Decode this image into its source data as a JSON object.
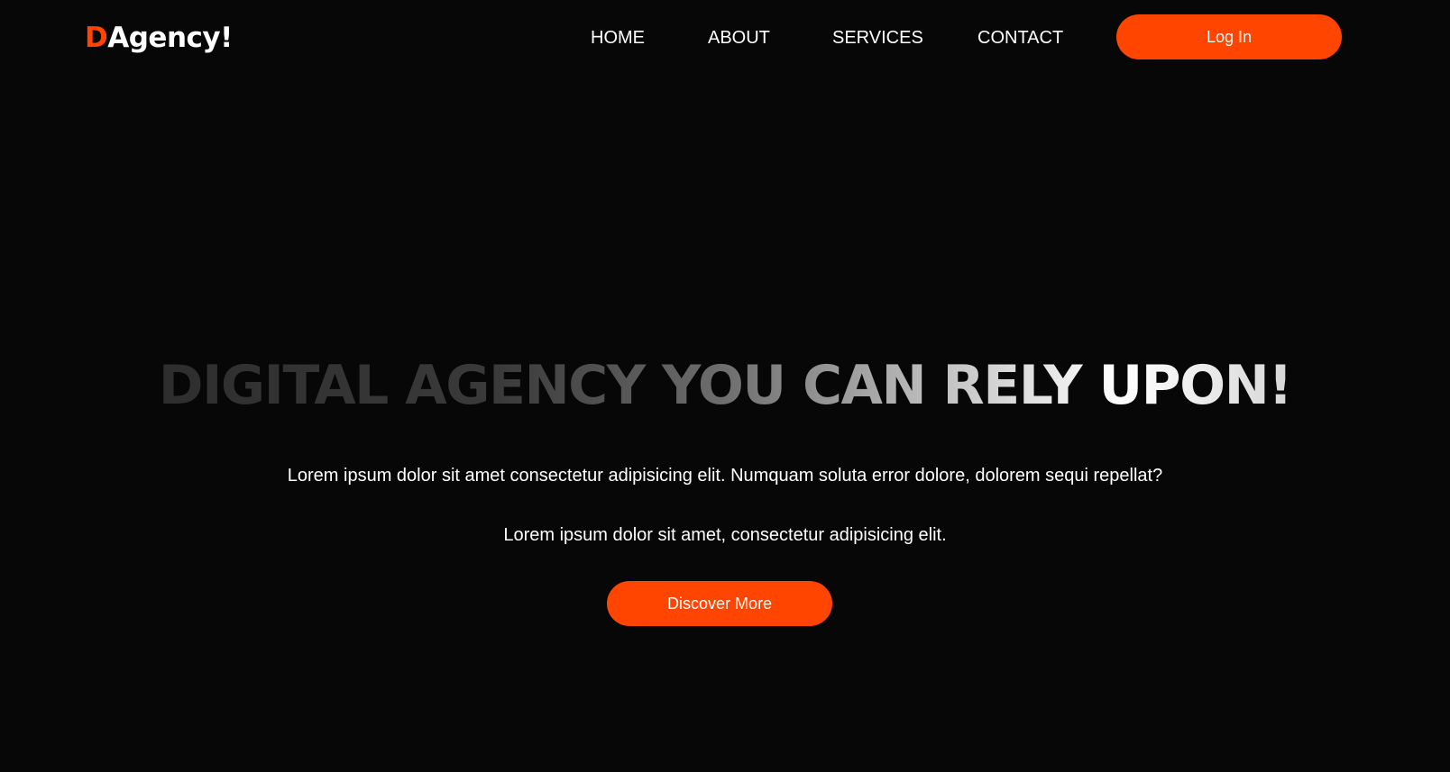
{
  "colors": {
    "background": "#070707",
    "accent": "#ff4500",
    "text": "#ffffff"
  },
  "header": {
    "logo": {
      "accent_letter": "D",
      "rest": "Agency!"
    },
    "nav": {
      "home": "HOME",
      "about": "ABOUT",
      "services": "SERVICES",
      "contact": "CONTACT"
    },
    "login_label": "Log In"
  },
  "hero": {
    "title": "DIGITAL AGENCY YOU CAN RELY UPON!",
    "subtitle_1": "Lorem ipsum dolor sit amet consectetur adipisicing elit. Numquam soluta error dolore, dolorem sequi repellat?",
    "subtitle_2": "Lorem ipsum dolor sit amet, consectetur adipisicing elit.",
    "cta_label": "Discover More"
  }
}
